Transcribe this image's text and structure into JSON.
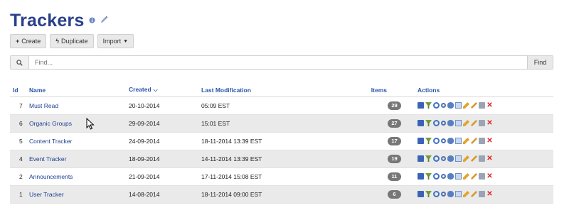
{
  "page": {
    "title": "Trackers",
    "title_icons": [
      "info-icon",
      "pencil-icon"
    ]
  },
  "toolbar": {
    "create_label": "Create",
    "duplicate_label": "Duplicate",
    "import_label": "Import"
  },
  "search": {
    "placeholder": "Find...",
    "button_label": "Find"
  },
  "table": {
    "columns": {
      "id": "Id",
      "name": "Name",
      "created": "Created",
      "last_modification": "Last Modification",
      "items": "Items",
      "actions": "Actions"
    },
    "sorted_column": "created",
    "rows": [
      {
        "id": "7",
        "name": "Must Read",
        "created": "20-10-2014",
        "last_modification": "05:09 EST",
        "items": "29"
      },
      {
        "id": "6",
        "name": "Organic Groups",
        "created": "29-09-2014",
        "last_modification": "15:01 EST",
        "items": "27"
      },
      {
        "id": "5",
        "name": "Content Tracker",
        "created": "24-09-2014",
        "last_modification": "18-11-2014 13:39 EST",
        "items": "17"
      },
      {
        "id": "4",
        "name": "Event Tracker",
        "created": "18-09-2014",
        "last_modification": "14-11-2014 13:39 EST",
        "items": "19"
      },
      {
        "id": "2",
        "name": "Announcements",
        "created": "21-09-2014",
        "last_modification": "17-11-2014 15:08 EST",
        "items": "11"
      },
      {
        "id": "1",
        "name": "User Tracker",
        "created": "14-08-2014",
        "last_modification": "18-11-2014 09:00 EST",
        "items": "6"
      }
    ],
    "row_actions": [
      "save-icon",
      "filter-icon",
      "refresh-icon",
      "search-icon",
      "view-icon",
      "sheet-icon",
      "pencil-icon",
      "edit-icon",
      "lock-icon",
      "delete-icon"
    ]
  },
  "colors": {
    "title": "#2a3f8a",
    "header_text": "#2a55a8",
    "link": "#1d3f8f",
    "badge": "#777777",
    "delete": "#dd2222"
  }
}
